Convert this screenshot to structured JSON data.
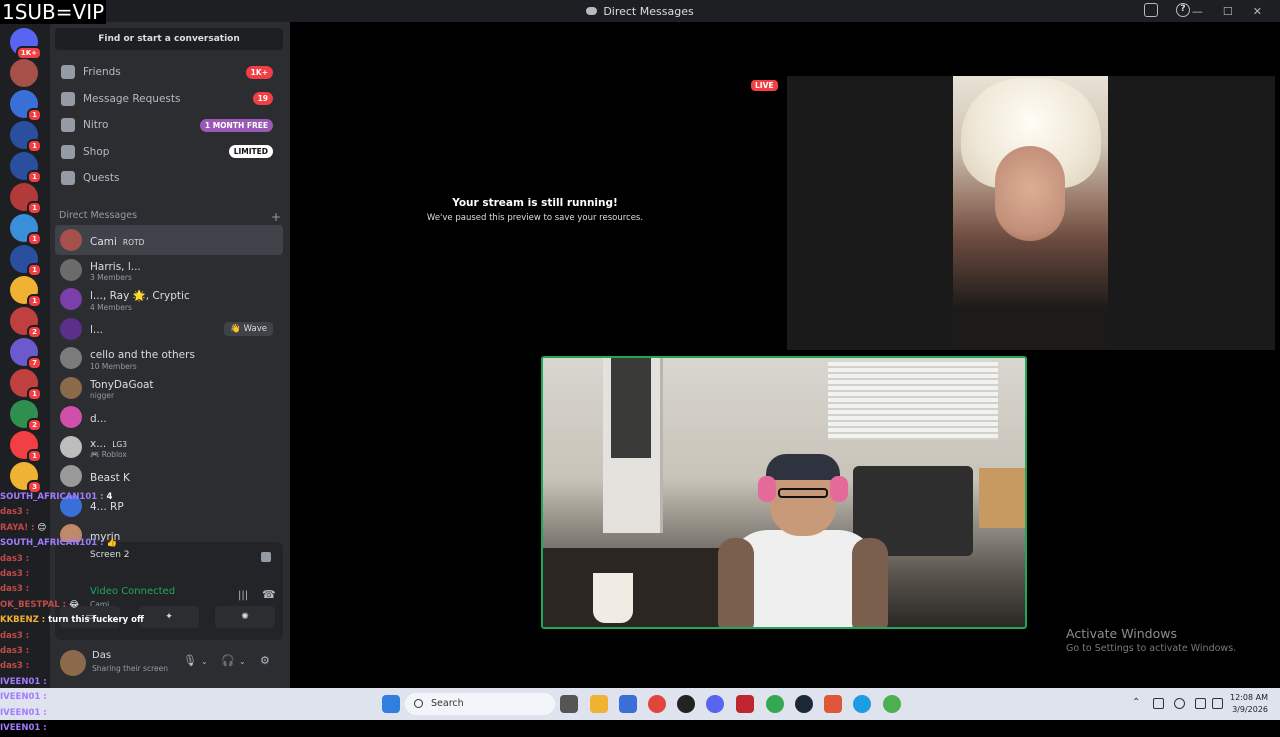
{
  "overlay_title": "1SUB=VIP",
  "window": {
    "title": "Direct Messages"
  },
  "servers": [
    {
      "badge": "1K+",
      "color": "#5865f2"
    },
    {
      "badge": "",
      "color": "#a6504a"
    },
    {
      "badge": "1",
      "color": "#3a6fd8"
    },
    {
      "badge": "1",
      "color": "#2a4f9e"
    },
    {
      "badge": "1",
      "color": "#2a4f9e"
    },
    {
      "badge": "1",
      "color": "#b23a3a"
    },
    {
      "badge": "1",
      "color": "#3a8fd8"
    },
    {
      "badge": "1",
      "color": "#2a4f9e"
    },
    {
      "badge": "1",
      "color": "#f0b232"
    },
    {
      "badge": "2",
      "color": "#c04040"
    },
    {
      "badge": "7",
      "color": "#6a5acd"
    },
    {
      "badge": "1",
      "color": "#c04040"
    },
    {
      "badge": "2",
      "color": "#2f8f4f"
    },
    {
      "badge": "1",
      "color": "#f23f43"
    },
    {
      "badge": "3",
      "color": "#f0b232"
    }
  ],
  "sidebar": {
    "search_placeholder": "Find or start a conversation",
    "nav": [
      {
        "label": "Friends",
        "pill": "1K+",
        "pill_color": "#f23f43"
      },
      {
        "label": "Message Requests",
        "pill": "19",
        "pill_color": "#f23f43"
      },
      {
        "label": "Nitro",
        "pill": "1 MONTH FREE",
        "pill_color": "#9b59b6"
      },
      {
        "label": "Shop",
        "pill": "LIMITED",
        "pill_color": "#ffffff"
      },
      {
        "label": "Quests",
        "pill": "",
        "pill_color": ""
      }
    ],
    "dm_header": "Direct Messages",
    "dm_add": "+",
    "dms": [
      {
        "name": "Cami",
        "tag": "ROTD",
        "sub": "",
        "color": "#a6504a",
        "active": true
      },
      {
        "name": "Harris, l...",
        "tag": "",
        "sub": "3 Members",
        "color": "#6b6b6b"
      },
      {
        "name": "l..., Ray 🌟, Cryptic",
        "tag": "",
        "sub": "4 Members",
        "color": "#7a3fa8"
      },
      {
        "name": "l...",
        "tag": "",
        "sub": "",
        "color": "#5b2f8a",
        "wave": "👋 Wave"
      },
      {
        "name": "cello and the others",
        "tag": "",
        "sub": "10 Members",
        "color": "#7b7b7b"
      },
      {
        "name": "TonyDaGoat",
        "tag": "",
        "sub": "nigger",
        "color": "#8a6a4a"
      },
      {
        "name": "d...",
        "tag": "",
        "sub": "",
        "color": "#d04fa8"
      },
      {
        "name": "x...",
        "tag": "LG3",
        "sub": "🎮 Roblox",
        "color": "#bdbdbd"
      },
      {
        "name": "Beast K",
        "tag": "",
        "sub": "",
        "color": "#9a9a9a"
      },
      {
        "name": "4... RP",
        "tag": "",
        "sub": "",
        "color": "#3a6fd8"
      },
      {
        "name": "myrin",
        "tag": "",
        "sub": "",
        "color": "#c08a6a"
      }
    ],
    "voice": {
      "screen_label": "Screen 2",
      "status": "Video Connected",
      "sub": "Cami"
    },
    "user": {
      "name": "Das",
      "status": "Sharing their screen"
    }
  },
  "chat_overlay": [
    {
      "user": "SOUTH_AFRICAN101 :",
      "msg": "4",
      "color": "#a07cff"
    },
    {
      "user": "das3 :",
      "msg": "",
      "color": "#c04a4a"
    },
    {
      "user": "RAYA! :",
      "msg": "😊",
      "color": "#c04a4a"
    },
    {
      "user": "SOUTH_AFRICAN101 :",
      "msg": "👍",
      "color": "#a07cff"
    },
    {
      "user": "das3 :",
      "msg": "",
      "color": "#c04a4a"
    },
    {
      "user": "das3 :",
      "msg": "",
      "color": "#c04a4a"
    },
    {
      "user": "das3 :",
      "msg": "",
      "color": "#c04a4a"
    },
    {
      "user": "OK_BESTPAL :",
      "msg": "😂",
      "color": "#c04a4a"
    },
    {
      "user": "KKBENZ :",
      "msg": "turn this fuckery off",
      "color": "#f0b232"
    },
    {
      "user": "das3 :",
      "msg": "",
      "color": "#c04a4a"
    },
    {
      "user": "das3 :",
      "msg": "",
      "color": "#c04a4a"
    },
    {
      "user": "das3 :",
      "msg": "",
      "color": "#c04a4a"
    },
    {
      "user": "IVEEN01 :",
      "msg": "",
      "color": "#a07cff"
    },
    {
      "user": "IVEEN01 :",
      "msg": "",
      "color": "#a07cff"
    },
    {
      "user": "IVEEN01 :",
      "msg": "",
      "color": "#a07cff"
    },
    {
      "user": "IVEEN01 :",
      "msg": "",
      "color": "#a07cff"
    }
  ],
  "stream": {
    "paused_title": "Your stream is still running!",
    "paused_sub": "We've paused this preview to save your resources.",
    "live_label": "LIVE"
  },
  "activation": {
    "title": "Activate Windows",
    "sub": "Go to Settings to activate Windows."
  },
  "taskbar": {
    "search": "Search",
    "time": "12:08 AM",
    "date": "3/9/2026"
  }
}
